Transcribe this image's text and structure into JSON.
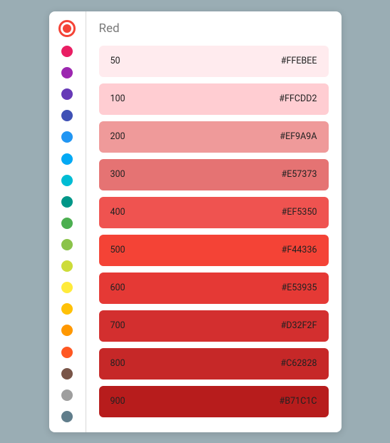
{
  "title": "Red",
  "sidebar": [
    {
      "name": "red",
      "color": "#F44336",
      "selected": true
    },
    {
      "name": "pink",
      "color": "#E91E63",
      "selected": false
    },
    {
      "name": "purple",
      "color": "#9C27B0",
      "selected": false
    },
    {
      "name": "deep-purple",
      "color": "#673AB7",
      "selected": false
    },
    {
      "name": "indigo",
      "color": "#3F51B5",
      "selected": false
    },
    {
      "name": "blue",
      "color": "#2196F3",
      "selected": false
    },
    {
      "name": "light-blue",
      "color": "#03A9F4",
      "selected": false
    },
    {
      "name": "cyan",
      "color": "#00BCD4",
      "selected": false
    },
    {
      "name": "teal",
      "color": "#009688",
      "selected": false
    },
    {
      "name": "green",
      "color": "#4CAF50",
      "selected": false
    },
    {
      "name": "light-green",
      "color": "#8BC34A",
      "selected": false
    },
    {
      "name": "lime",
      "color": "#CDDC39",
      "selected": false
    },
    {
      "name": "yellow",
      "color": "#FFEB3B",
      "selected": false
    },
    {
      "name": "amber",
      "color": "#FFC107",
      "selected": false
    },
    {
      "name": "orange",
      "color": "#FF9800",
      "selected": false
    },
    {
      "name": "deep-orange",
      "color": "#FF5722",
      "selected": false
    },
    {
      "name": "brown",
      "color": "#795548",
      "selected": false
    },
    {
      "name": "grey",
      "color": "#9E9E9E",
      "selected": false
    },
    {
      "name": "blue-grey",
      "color": "#607D8B",
      "selected": false
    }
  ],
  "swatches": [
    {
      "shade": "50",
      "hex": "#FFEBEE",
      "bg": "#FFEBEE",
      "text": "#212121"
    },
    {
      "shade": "100",
      "hex": "#FFCDD2",
      "bg": "#FFCDD2",
      "text": "#212121"
    },
    {
      "shade": "200",
      "hex": "#EF9A9A",
      "bg": "#EF9A9A",
      "text": "#212121"
    },
    {
      "shade": "300",
      "hex": "#E57373",
      "bg": "#E57373",
      "text": "#212121"
    },
    {
      "shade": "400",
      "hex": "#EF5350",
      "bg": "#EF5350",
      "text": "#212121"
    },
    {
      "shade": "500",
      "hex": "#F44336",
      "bg": "#F44336",
      "text": "#212121"
    },
    {
      "shade": "600",
      "hex": "#E53935",
      "bg": "#E53935",
      "text": "#212121"
    },
    {
      "shade": "700",
      "hex": "#D32F2F",
      "bg": "#D32F2F",
      "text": "#212121"
    },
    {
      "shade": "800",
      "hex": "#C62828",
      "bg": "#C62828",
      "text": "#212121"
    },
    {
      "shade": "900",
      "hex": "#B71C1C",
      "bg": "#B71C1C",
      "text": "#212121"
    }
  ]
}
